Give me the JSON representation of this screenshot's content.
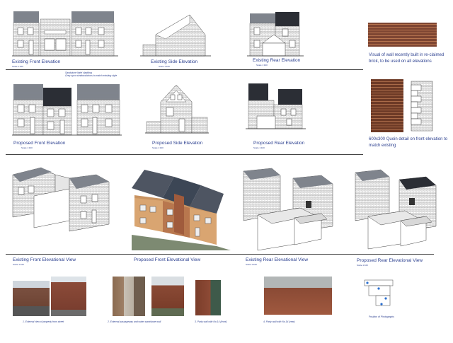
{
  "sheet": {
    "row1": {
      "front": "Existing Front Elevation",
      "front_scale": "Scale 1:100",
      "side": "Existing Side Elevation",
      "side_scale": "Scale 1:100",
      "rear": "Existing Rear Elevation",
      "rear_scale": "Scale 1:100",
      "note": "Visual of wall recently built in re-claimed brick, to be used on all elevations"
    },
    "row2": {
      "front": "Proposed Front Elevation",
      "front_scale": "Scale 1:100",
      "front_annotation_1": "Sandstone lintel cladding",
      "front_annotation_2": "Grey upvc windows/doors to match existing style",
      "side": "Proposed Side Elevation",
      "side_scale": "Scale 1:100",
      "rear": "Proposed Rear Elevation",
      "rear_scale": "Scale 1:100",
      "note": "600x300 Quoin detail on front elevation to match existing"
    },
    "row3": {
      "ex_front": "Existing Front Elevational View",
      "ex_front_scale": "Scale 1:100",
      "pr_front": "Proposed Front Elevational View",
      "ex_rear": "Existing Rear Elevational View",
      "ex_rear_scale": "Scale 1:100",
      "pr_rear": "Proposed Rear Elevational View",
      "pr_rear_scale": "Scale 1:100"
    },
    "photos": {
      "p1": "1. External view of property from street",
      "p2": "2. External passageway and water sandstone wall",
      "p3": "3. Party wall with No.14 (front)",
      "p4": "4. Party wall with No.14 (rear)",
      "p5": "Position of Photographs"
    },
    "colors": {
      "caption": "#2b3f8f",
      "line": "#444444",
      "brick": "#9a5a3e",
      "roof": "#3c4655"
    }
  }
}
